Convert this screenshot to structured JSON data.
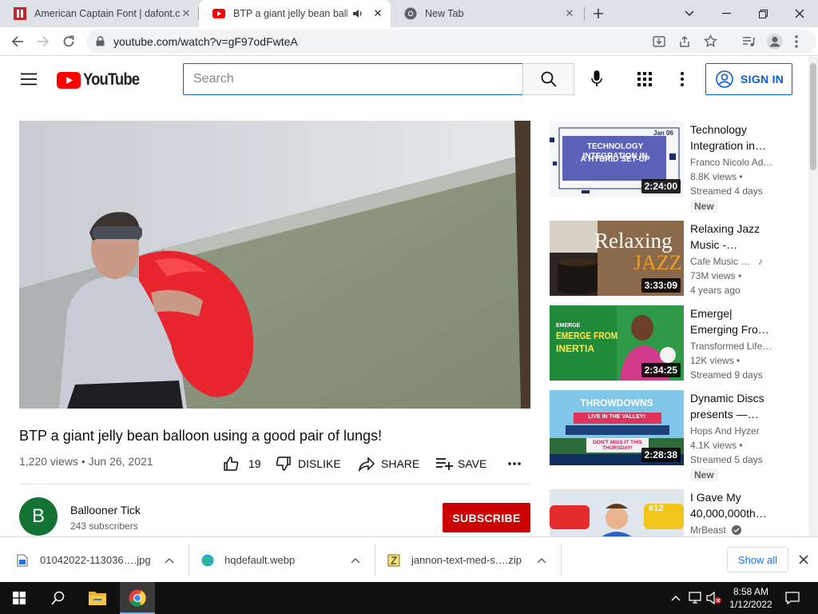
{
  "tabs": [
    {
      "title": "American Captain Font | dafont.com",
      "close": "✕"
    },
    {
      "title": "BTP a giant jelly bean balloon using a good pair of lungs! - YouTube",
      "close": "✕"
    },
    {
      "title": "New Tab",
      "close": "✕"
    }
  ],
  "browser": {
    "url": "youtube.com/watch?v=gF97odFwteA"
  },
  "youtube": {
    "logo_text": "YouTube",
    "search_placeholder": "Search",
    "signin_label": "SIGN IN",
    "brand_red": "#ff0000"
  },
  "video": {
    "title": "BTP a giant jelly bean balloon using a good pair of lungs!",
    "meta": "1,220 views • Jun 26, 2021",
    "like_count": "19",
    "dislike_label": "DISLIKE",
    "share_label": "SHARE",
    "save_label": "SAVE"
  },
  "channel": {
    "avatar_letter": "B",
    "name": "Ballooner Tick",
    "subscribers": "243 subscribers",
    "subscribe_label": "SUBSCRIBE"
  },
  "recommendations": [
    {
      "title": "Technology Integration in…",
      "channel": "Franco Nicolo Ad…",
      "views": "8.8K views •",
      "age": "Streamed 4 days",
      "duration": "2:24:00",
      "badge": "New",
      "thumb_text1": "TECHNOLOGY INTEGRATION IN",
      "thumb_text2": "A HYBRID SET-UP",
      "thumb_text3": "Jan 06"
    },
    {
      "title": "Relaxing Jazz Music -…",
      "channel": "Cafe Music …",
      "views": "73M views •",
      "age": "4 years ago",
      "duration": "3:33:09",
      "badge": "",
      "thumb_text1": "Relaxing",
      "thumb_text2": "JAZZ",
      "thumb_text3": ""
    },
    {
      "title": "Emerge| Emerging Fro…",
      "channel": "Transformed Life…",
      "views": "12K views •",
      "age": "Streamed 9 days",
      "duration": "2:34:25",
      "badge": "",
      "thumb_text1": "EMERGE FROM",
      "thumb_text2": "INERTIA",
      "thumb_text3": "EMERGE"
    },
    {
      "title": "Dynamic Discs presents —…",
      "channel": "Hops And Hyzer",
      "views": "4.1K views •",
      "age": "Streamed 5 days",
      "duration": "2:28:38",
      "badge": "New",
      "thumb_text1": "THROWDOWNS",
      "thumb_text2": "LIVE IN THE VALLEY!",
      "thumb_text3": "DON'T MISS IT THIS THURSDAY!"
    },
    {
      "title": "I Gave My 40,000,000th…",
      "channel": "MrBeast",
      "views": "",
      "age": "",
      "duration": "",
      "badge": "",
      "thumb_text1": "#12",
      "thumb_text2": "",
      "thumb_text3": ""
    }
  ],
  "downloads": [
    {
      "name": "01042022-113036….jpg"
    },
    {
      "name": "hqdefault.webp"
    },
    {
      "name": "jannon-text-med-s….zip"
    }
  ],
  "downloads_showall": "Show all",
  "taskbar": {
    "time": "8:58 AM",
    "date": "1/12/2022"
  }
}
